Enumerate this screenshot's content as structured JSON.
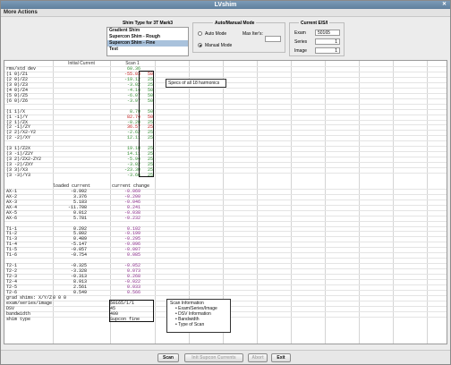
{
  "window": {
    "title": "LVshim"
  },
  "menu": {
    "label": "More Actions"
  },
  "shim_type": {
    "title": "Shim Type for 3T Mark3",
    "items": [
      "Gradient Shim",
      "Supercon Shim - Rough",
      "Supercon Shim - Fine",
      "Test"
    ]
  },
  "mode": {
    "title": "Auto/Manual Mode",
    "auto": "Auto Mode",
    "manual": "Manual Mode",
    "max_iter_label": "Max Iter's:",
    "max_iter_value": ""
  },
  "current_esi": {
    "title": "Current E/S/I",
    "exam_label": "Exam",
    "exam_value": "50165",
    "series_label": "Series",
    "series_value": "1",
    "image_label": "Image",
    "image_value": "1"
  },
  "columns": {
    "initial": "Initial Current",
    "scan1": "Scan 1"
  },
  "harmonics": [
    {
      "label": "rms/std dev",
      "value": "60.36",
      "limit": ""
    },
    {
      "label": "(1 0)/Z1",
      "value": "-55.03",
      "limit": "50"
    },
    {
      "label": "(2 0)/Z2",
      "value": "-19.12",
      "limit": "25"
    },
    {
      "label": "(3 0)/Z3",
      "value": "-3.02",
      "limit": "25"
    },
    {
      "label": "(4 0)/Z4",
      "value": "-4.14",
      "limit": "50"
    },
    {
      "label": "(5 0)/Z5",
      "value": "-6.07",
      "limit": "50"
    },
    {
      "label": "(6 0)/Z6",
      "value": "-3.97",
      "limit": "50"
    },
    {
      "label": "",
      "value": "",
      "limit": ""
    },
    {
      "label": "(1 1)/X",
      "value": "8.70",
      "limit": "50"
    },
    {
      "label": "(1 -1)/Y",
      "value": "82.74",
      "limit": "50"
    },
    {
      "label": "(2 1)/ZX",
      "value": "-8.28",
      "limit": "25"
    },
    {
      "label": "(2 -1)/ZY",
      "value": "36.57",
      "limit": "25"
    },
    {
      "label": "(2 2)/X2-Y2",
      "value": "-2.62",
      "limit": "25"
    },
    {
      "label": "(2 -2)/XY",
      "value": "12.11",
      "limit": "25"
    },
    {
      "label": "",
      "value": "",
      "limit": ""
    },
    {
      "label": "(3 1)/Z2X",
      "value": "19.18",
      "limit": "25"
    },
    {
      "label": "(3 -1)/Z2Y",
      "value": "14.11",
      "limit": "25"
    },
    {
      "label": "(3 2)/ZX2-ZY2",
      "value": "-5.94",
      "limit": "25"
    },
    {
      "label": "(3 -2)/ZXY",
      "value": "-3.02",
      "limit": "25"
    },
    {
      "label": "(3 3)/X3",
      "value": "-23.30",
      "limit": "25"
    },
    {
      "label": "(3 -3)/Y3",
      "value": "-3.66",
      "limit": "25"
    }
  ],
  "loaded_header": {
    "current": "loaded current",
    "change": "current change"
  },
  "coils": [
    {
      "label": "AX-1",
      "current": "-8.992",
      "change": "-0.069"
    },
    {
      "label": "AX-2",
      "current": "3.376",
      "change": "-0.200"
    },
    {
      "label": "AX-3",
      "current": "5.183",
      "change": "-0.046"
    },
    {
      "label": "AX-4",
      "current": "-11.708",
      "change": "0.241"
    },
    {
      "label": "AX-5",
      "current": "0.012",
      "change": "-0.038"
    },
    {
      "label": "AX-6",
      "current": "5.781",
      "change": "-0.232"
    },
    {
      "label": "",
      "current": "",
      "change": ""
    },
    {
      "label": "T1-1",
      "current": "0.202",
      "change": "0.102"
    },
    {
      "label": "T1-2",
      "current": "5.802",
      "change": "-0.199"
    },
    {
      "label": "T1-3",
      "current": "0.489",
      "change": "-0.295"
    },
    {
      "label": "T1-4",
      "current": "-5.147",
      "change": "-0.096"
    },
    {
      "label": "T1-5",
      "current": "-0.057",
      "change": "-0.007"
    },
    {
      "label": "T1-6",
      "current": "-0.754",
      "change": "0.085"
    },
    {
      "label": "",
      "current": "",
      "change": ""
    },
    {
      "label": "T2-1",
      "current": "-0.325",
      "change": "-0.052"
    },
    {
      "label": "T2-2",
      "current": "-3.328",
      "change": "0.073"
    },
    {
      "label": "T2-3",
      "current": "-0.313",
      "change": "0.268"
    },
    {
      "label": "T2-4",
      "current": "8.913",
      "change": "-0.022"
    },
    {
      "label": "T2-5",
      "current": "2.561",
      "change": "0.033"
    },
    {
      "label": "T2-6",
      "current": "0.549",
      "change": "0.566"
    }
  ],
  "footer_rows": [
    {
      "label": "grad shims: X/Y/Z",
      "value": "0    0    0"
    },
    {
      "label": "exam/series/image",
      "value": "50165/1/1"
    },
    {
      "label": "DSV",
      "value": "45"
    },
    {
      "label": "bandwidth",
      "value": "400"
    },
    {
      "label": "shim type",
      "value": "Supcon fine"
    }
  ],
  "callout_specs": {
    "text": "Specs of all 18 harmonics"
  },
  "callout_scan": {
    "title": "Scan Information",
    "items": [
      "Exam/Series/Image",
      "DSV Information",
      "Bandwidth",
      "Type of Scan"
    ]
  },
  "buttons": {
    "scan": "Scan",
    "init": "Init Supcon Currents",
    "abort": "Abort",
    "exit": "Exit"
  }
}
